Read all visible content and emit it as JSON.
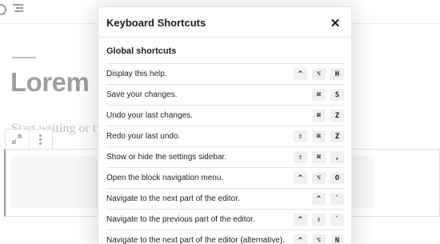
{
  "editor": {
    "post_title": "Lorem Ipsum",
    "body_placeholder": "Start writing or type / to choose a block"
  },
  "modal": {
    "title": "Keyboard Shortcuts",
    "close_symbol": "✕",
    "section_title": "Global shortcuts",
    "shortcuts": [
      {
        "description": "Display this help.",
        "keys": [
          "^",
          "⌥",
          "H"
        ]
      },
      {
        "description": "Save your changes.",
        "keys": [
          "⌘",
          "S"
        ]
      },
      {
        "description": "Undo your last changes.",
        "keys": [
          "⌘",
          "Z"
        ]
      },
      {
        "description": "Redo your last undo.",
        "keys": [
          "⇧",
          "⌘",
          "Z"
        ]
      },
      {
        "description": "Show or hide the settings sidebar.",
        "keys": [
          "⇧",
          "⌘",
          ","
        ]
      },
      {
        "description": "Open the block navigation menu.",
        "keys": [
          "^",
          "⌥",
          "O"
        ]
      },
      {
        "description": "Navigate to the next part of the editor.",
        "keys": [
          "^",
          "`"
        ]
      },
      {
        "description": "Navigate to the previous part of the editor.",
        "keys": [
          "^",
          "⇧",
          "`"
        ]
      },
      {
        "description": "Navigate to the next part of the editor (alternative).",
        "keys": [
          "^",
          "⌥",
          "N"
        ]
      }
    ]
  },
  "icons": {
    "info": "info-icon",
    "outline": "outline-icon",
    "move": "move-arrows-icon",
    "more": "more-vertical-icon",
    "close": "close-icon"
  }
}
